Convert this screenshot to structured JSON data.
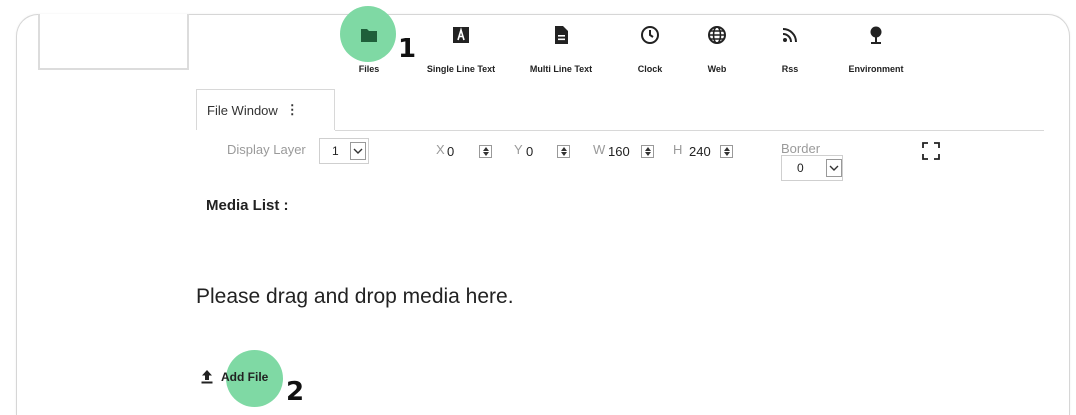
{
  "toolbar": {
    "items": [
      {
        "label": "Files",
        "icon": "folder-icon"
      },
      {
        "label": "Single Line Text",
        "icon": "text-a-icon"
      },
      {
        "label": "Multi Line Text",
        "icon": "document-icon"
      },
      {
        "label": "Clock",
        "icon": "clock-icon"
      },
      {
        "label": "Web",
        "icon": "globe-icon"
      },
      {
        "label": "Rss",
        "icon": "rss-icon"
      },
      {
        "label": "Environment",
        "icon": "tree-icon"
      }
    ]
  },
  "markers": {
    "one": "1",
    "two": "2"
  },
  "tab": {
    "label": "File Window",
    "menu_glyph": "⋮"
  },
  "properties": {
    "display_layer_label": "Display Layer",
    "display_layer_value": "1",
    "x_label": "X",
    "x_value": "0",
    "y_label": "Y",
    "y_value": "0",
    "w_label": "W",
    "w_value": "160",
    "h_label": "H",
    "h_value": "240",
    "border_label": "Border",
    "border_value": "0"
  },
  "media": {
    "list_label": "Media List :",
    "drop_hint": "Please drag and drop media here.",
    "add_file_label": "Add File"
  },
  "colors": {
    "highlight": "#7fd9a4",
    "folder": "#1f5f3a"
  }
}
